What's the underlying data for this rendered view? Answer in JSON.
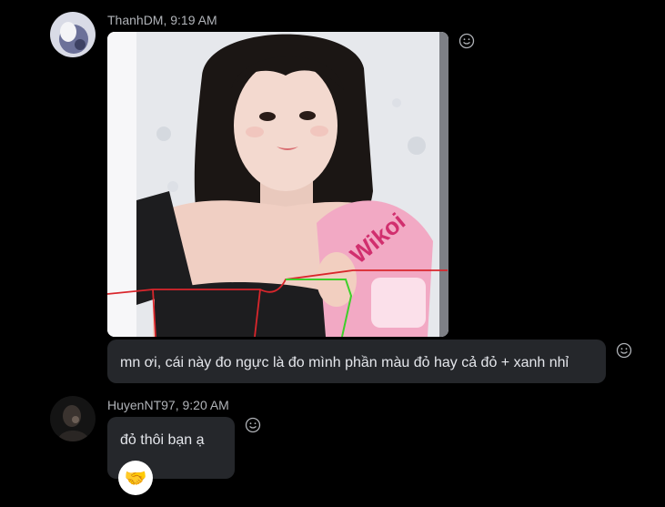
{
  "messages": [
    {
      "author": "ThanhDM",
      "time": "9:19 AM",
      "header": "ThanhDM, 9:19 AM",
      "attachment": "photo",
      "text": "mn ơi, cái này đo ngực là đo mình phần màu đỏ hay cả đỏ + xanh nhỉ",
      "reaction_button_icon": "smiley-add-reaction-icon"
    },
    {
      "author": "HuyenNT97",
      "time": "9:20 AM",
      "header": "HuyenNT97, 9:20 AM",
      "text": "đỏ thôi bạn ạ",
      "reaction_button_icon": "smiley-add-reaction-icon",
      "reaction": {
        "emoji": "🤝",
        "icon": "handshake-icon"
      }
    }
  ],
  "photo_overlay": {
    "candy_label": "Wikoi",
    "red_line_color": "#d9262c",
    "green_line_color": "#3ecf2a"
  },
  "colors": {
    "background": "#000000",
    "bubble": "#25272b",
    "meta_text": "#b0b3b8",
    "message_text": "#e4e6eb"
  }
}
